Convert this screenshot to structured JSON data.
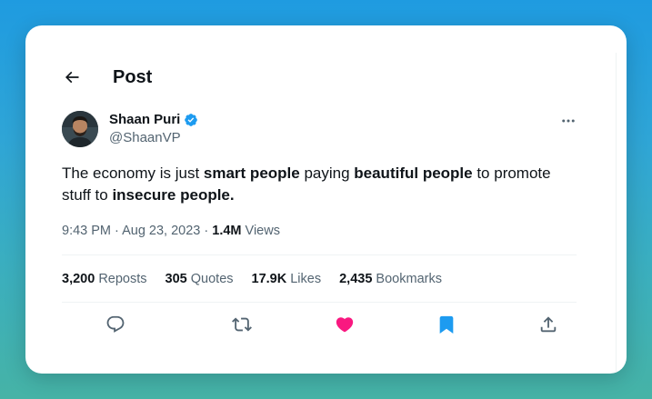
{
  "header": {
    "title": "Post"
  },
  "author": {
    "display_name": "Shaan Puri",
    "handle": "@ShaanVP",
    "verified": true
  },
  "tweet": {
    "segments": [
      {
        "text": "The economy is just ",
        "bold": false
      },
      {
        "text": "smart people",
        "bold": true
      },
      {
        "text": " paying ",
        "bold": false
      },
      {
        "text": "beautiful people",
        "bold": true
      },
      {
        "text": " to promote stuff to ",
        "bold": false
      },
      {
        "text": "insecure people.",
        "bold": true
      }
    ]
  },
  "meta": {
    "time": "9:43 PM",
    "separator": " · ",
    "date": "Aug 23, 2023",
    "views_count": "1.4M",
    "views_label": " Views"
  },
  "stats": {
    "reposts": {
      "count": "3,200",
      "label": " Reposts"
    },
    "quotes": {
      "count": "305",
      "label": " Quotes"
    },
    "likes": {
      "count": "17.9K",
      "label": " Likes"
    },
    "bookmarks": {
      "count": "2,435",
      "label": " Bookmarks"
    }
  },
  "actions": {
    "reply_icon": "reply-icon",
    "repost_icon": "repost-icon",
    "like_icon": "heart-icon",
    "bookmark_icon": "bookmark-icon",
    "share_icon": "share-icon",
    "liked": true,
    "bookmarked": true
  },
  "colors": {
    "like": "#f91880",
    "bookmark": "#1d9bf0",
    "verified": "#1d9bf0",
    "icon_gray": "#536471"
  }
}
